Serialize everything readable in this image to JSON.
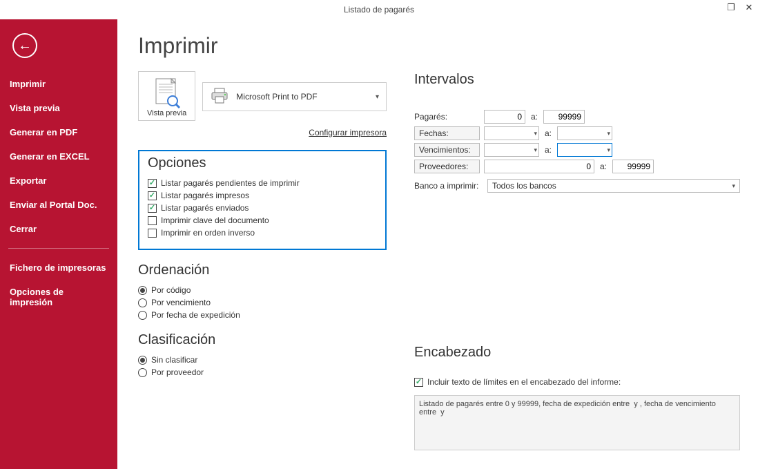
{
  "titlebar": {
    "title": "Listado de pagarés"
  },
  "sidebar": {
    "items": [
      "Imprimir",
      "Vista previa",
      "Generar en PDF",
      "Generar en EXCEL",
      "Exportar",
      "Enviar al Portal Doc.",
      "Cerrar"
    ],
    "secondary": [
      "Fichero de impresoras",
      "Opciones de impresión"
    ]
  },
  "page": {
    "title": "Imprimir",
    "preview_label": "Vista previa",
    "printer_name": "Microsoft Print to PDF",
    "config_link": "Configurar impresora"
  },
  "options": {
    "title": "Opciones",
    "items": [
      {
        "label": "Listar pagarés pendientes de imprimir",
        "checked": true
      },
      {
        "label": "Listar pagarés impresos",
        "checked": true
      },
      {
        "label": "Listar pagarés enviados",
        "checked": true
      },
      {
        "label": "Imprimir clave del documento",
        "checked": false
      },
      {
        "label": "Imprimir en orden inverso",
        "checked": false
      }
    ]
  },
  "ordering": {
    "title": "Ordenación",
    "items": [
      {
        "label": "Por código",
        "checked": true
      },
      {
        "label": "Por vencimiento",
        "checked": false
      },
      {
        "label": "Por fecha de expedición",
        "checked": false
      }
    ]
  },
  "classification": {
    "title": "Clasificación",
    "items": [
      {
        "label": "Sin clasificar",
        "checked": true
      },
      {
        "label": "Por proveedor",
        "checked": false
      }
    ]
  },
  "intervals": {
    "title": "Intervalos",
    "pagares_label": "Pagarés:",
    "pagares_from": "0",
    "a": "a:",
    "pagares_to": "99999",
    "fechas_label": "Fechas:",
    "venc_label": "Vencimientos:",
    "prov_label": "Proveedores:",
    "prov_from": "0",
    "prov_to": "99999",
    "bank_label": "Banco a imprimir:",
    "bank_value": "Todos los bancos"
  },
  "header": {
    "title": "Encabezado",
    "check_label": "Incluir texto de límites en el encabezado del informe:",
    "text": "Listado de pagarés entre 0 y 99999, fecha de expedición entre  y , fecha de vencimiento entre  y"
  }
}
